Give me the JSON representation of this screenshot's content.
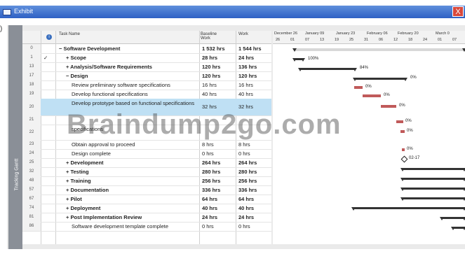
{
  "window": {
    "title": "Exhibit",
    "close_glyph": "X"
  },
  "side_marker": ")",
  "view_tab": "Tracking Gantt",
  "columns": {
    "info": "i",
    "task_name": "Task Name",
    "baseline": "Baseline Work",
    "work": "Work"
  },
  "tasks": [
    {
      "id": "0",
      "ind": "",
      "name": "− Software Development",
      "baseline": "1 532 hrs",
      "work": "1 544 hrs",
      "bold": true
    },
    {
      "id": "1",
      "ind": "✓",
      "name": "+ Scope",
      "baseline": "28 hrs",
      "work": "24 hrs",
      "bold": true
    },
    {
      "id": "13",
      "ind": "",
      "name": "+ Analysis/Software Requirements",
      "baseline": "120 hrs",
      "work": "136 hrs",
      "bold": true
    },
    {
      "id": "17",
      "ind": "",
      "name": "− Design",
      "baseline": "120 hrs",
      "work": "120 hrs",
      "bold": true
    },
    {
      "id": "18",
      "ind": "",
      "name": "Review preliminary software specifications",
      "baseline": "16 hrs",
      "work": "16 hrs",
      "bold": false
    },
    {
      "id": "19",
      "ind": "",
      "name": "Develop functional specifications",
      "baseline": "40 hrs",
      "work": "40 hrs",
      "bold": false
    },
    {
      "id": "20",
      "ind": "",
      "name": "Develop prototype based on functional specifications",
      "baseline": "32 hrs",
      "work": "32 hrs",
      "bold": false
    },
    {
      "id": "21",
      "ind": "",
      "name": "",
      "baseline": "",
      "work": "",
      "bold": false
    },
    {
      "id": "22",
      "ind": "",
      "name": "specifications",
      "baseline": "",
      "work": "",
      "bold": false
    },
    {
      "id": "23",
      "ind": "",
      "name": "Obtain approval to proceed",
      "baseline": "8 hrs",
      "work": "8 hrs",
      "bold": false
    },
    {
      "id": "24",
      "ind": "",
      "name": "Design complete",
      "baseline": "0 hrs",
      "work": "0 hrs",
      "bold": false
    },
    {
      "id": "25",
      "ind": "",
      "name": "+ Development",
      "baseline": "264 hrs",
      "work": "264 hrs",
      "bold": true
    },
    {
      "id": "32",
      "ind": "",
      "name": "+ Testing",
      "baseline": "280 hrs",
      "work": "280 hrs",
      "bold": true
    },
    {
      "id": "48",
      "ind": "",
      "name": "+ Training",
      "baseline": "256 hrs",
      "work": "256 hrs",
      "bold": true
    },
    {
      "id": "57",
      "ind": "",
      "name": "+ Documentation",
      "baseline": "336 hrs",
      "work": "336 hrs",
      "bold": true
    },
    {
      "id": "67",
      "ind": "",
      "name": "+ Pilot",
      "baseline": "64 hrs",
      "work": "64 hrs",
      "bold": true
    },
    {
      "id": "74",
      "ind": "",
      "name": "+ Deployment",
      "baseline": "40 hrs",
      "work": "40 hrs",
      "bold": true
    },
    {
      "id": "81",
      "ind": "",
      "name": "+ Post Implementation Review",
      "baseline": "24 hrs",
      "work": "24 hrs",
      "bold": true
    },
    {
      "id": "86",
      "ind": "",
      "name": "Software development template complete",
      "baseline": "0 hrs",
      "work": "0 hrs",
      "bold": false
    }
  ],
  "timescale": {
    "months": [
      "December 26",
      "January 09",
      "January 23",
      "February 06",
      "February 20",
      "March 0"
    ],
    "days": [
      "26",
      "01",
      "07",
      "13",
      "19",
      "25",
      "31",
      "06",
      "12",
      "18",
      "24",
      "01",
      "07"
    ]
  },
  "gantt_labels": {
    "scope": "100%",
    "analysis": "84%",
    "design": "0%",
    "review": "0%",
    "functional": "0%",
    "prototype": "0%",
    "row21": "0%",
    "row22": "0%",
    "approval": "0%",
    "milestone": "02-17"
  },
  "watermark": "Braindump2go.com"
}
